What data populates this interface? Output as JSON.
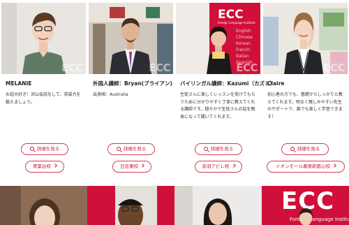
{
  "brand": {
    "watermark": "ECC",
    "primary": "#d0103a",
    "accent": "#c3193f"
  },
  "cards": [
    {
      "name": "MELANIE",
      "desc": "お話大好き！沢山会話をして、英語力を鍛えましょう。",
      "detail": "詳細を見る",
      "school": "青葉台校"
    },
    {
      "name": "外国人講師：Bryan(ブライアン)",
      "desc": "出身国：Australia",
      "detail": "詳細を見る",
      "school": "日吉東校"
    },
    {
      "name": "バイリンガル講師：Kazumi（カズミ）",
      "desc": "生徒さんに楽しくレッスンを受けてもらうために分かりやすく丁寧に教えてくれる講師です。穏やかで生徒さんの話を親身になって聞いてくれます。",
      "detail": "詳細を見る",
      "school": "赤羽アピレ校"
    },
    {
      "name": "Claire",
      "desc": "初心者の方でも、基礎からしっかりと教えてくれます。明るく親しみやすい先生のサポートで、誰でも楽しく学習できます！",
      "detail": "詳細を見る",
      "school": "イオンモール幕張新都心校"
    }
  ],
  "banner": {
    "logo": "ECC",
    "sub": "Foreign Language Institute",
    "languages": [
      "English",
      "Chinese",
      "Korean",
      "French",
      "Italian",
      "Spanish"
    ],
    "bottom_logo": "ECC",
    "bottom_sub": "Foreign Language Institute"
  }
}
